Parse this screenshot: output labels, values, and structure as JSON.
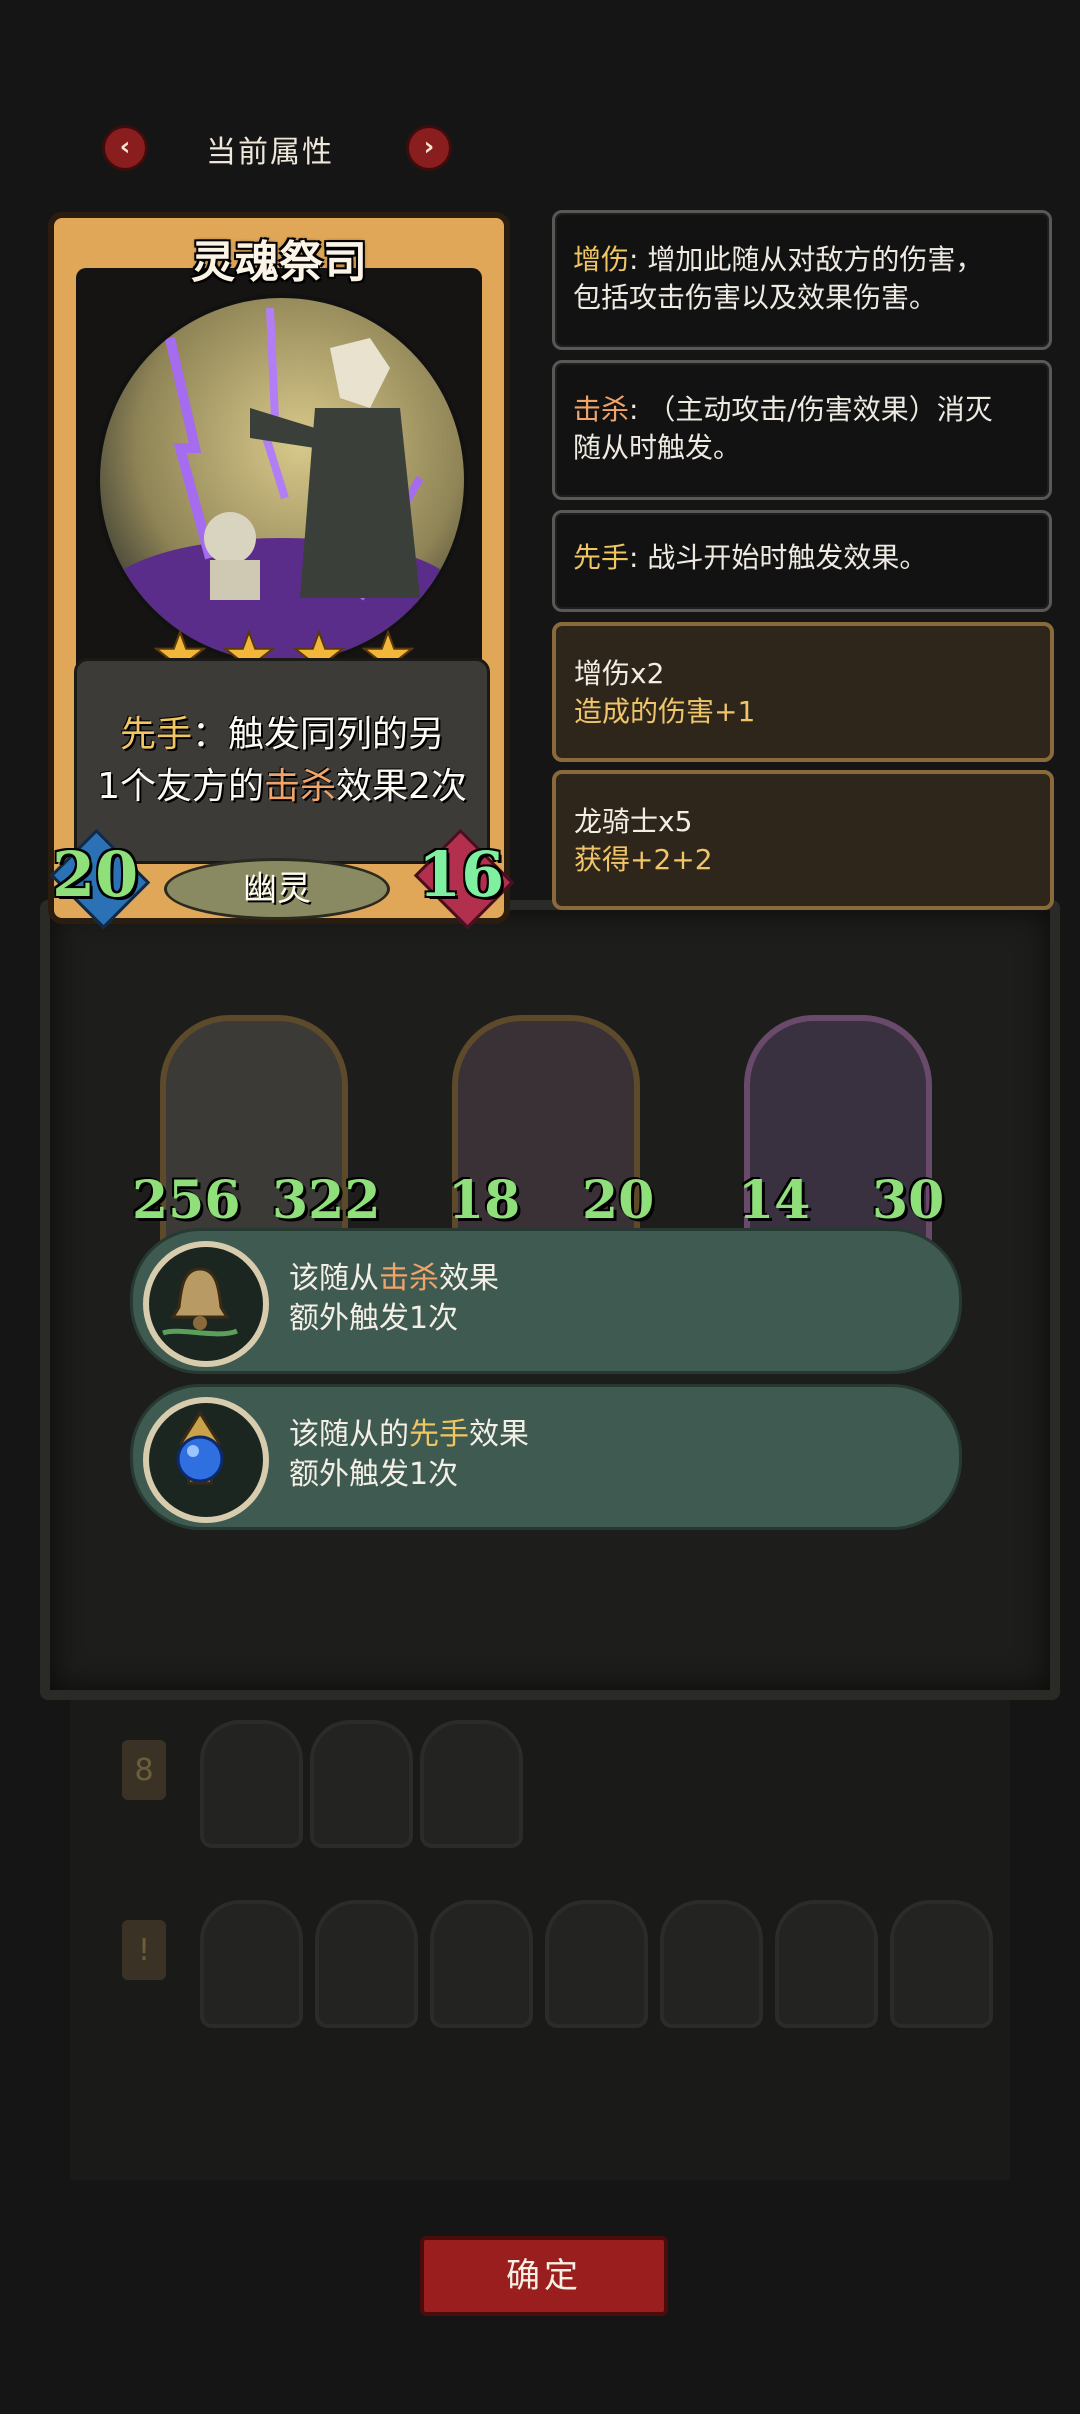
{
  "header": {
    "title": "当前属性",
    "prev_label": "‹",
    "next_label": "›"
  },
  "card": {
    "name": "灵魂祭司",
    "stars": 4,
    "ability": {
      "kw1": "先手",
      "part1": "：触发同列的另",
      "part2": "1个友方的",
      "kw2": "击杀",
      "part3": "效果2次"
    },
    "attack": "20",
    "health": "16",
    "type": "幽灵"
  },
  "info_boxes": [
    {
      "keyword": "增伤",
      "line1": ": 增加此随从对敌方的伤害，",
      "line2": "包括攻击伤害以及效果伤害。"
    },
    {
      "keyword": "击杀",
      "line1": ": （主动攻击/伤害效果）消灭",
      "line2": "随从时触发。"
    },
    {
      "keyword": "先手",
      "line1": ": 战斗开始时触发效果。",
      "line2": ""
    }
  ],
  "buffs": [
    {
      "title": "增伤x2",
      "desc": "造成的伤害+1"
    },
    {
      "title": "龙骑士x5",
      "desc": "获得+2+2"
    }
  ],
  "minions": [
    {
      "attack": "256",
      "health": "322"
    },
    {
      "attack": "18",
      "health": "20"
    },
    {
      "attack": "14",
      "health": "30"
    }
  ],
  "banners": [
    {
      "pre": "该随从",
      "kw": "击杀",
      "post": "效果",
      "line2": "额外触发1次",
      "icon": "bell-icon"
    },
    {
      "pre": "该随从的",
      "kw": "先手",
      "post": "效果",
      "line2": "额外触发1次",
      "icon": "blue-orb-icon"
    }
  ],
  "confirm_label": "确定",
  "colors": {
    "keyword": "#f0c662",
    "confirm": "#9a1e1e",
    "banner": "#3f5a50"
  }
}
